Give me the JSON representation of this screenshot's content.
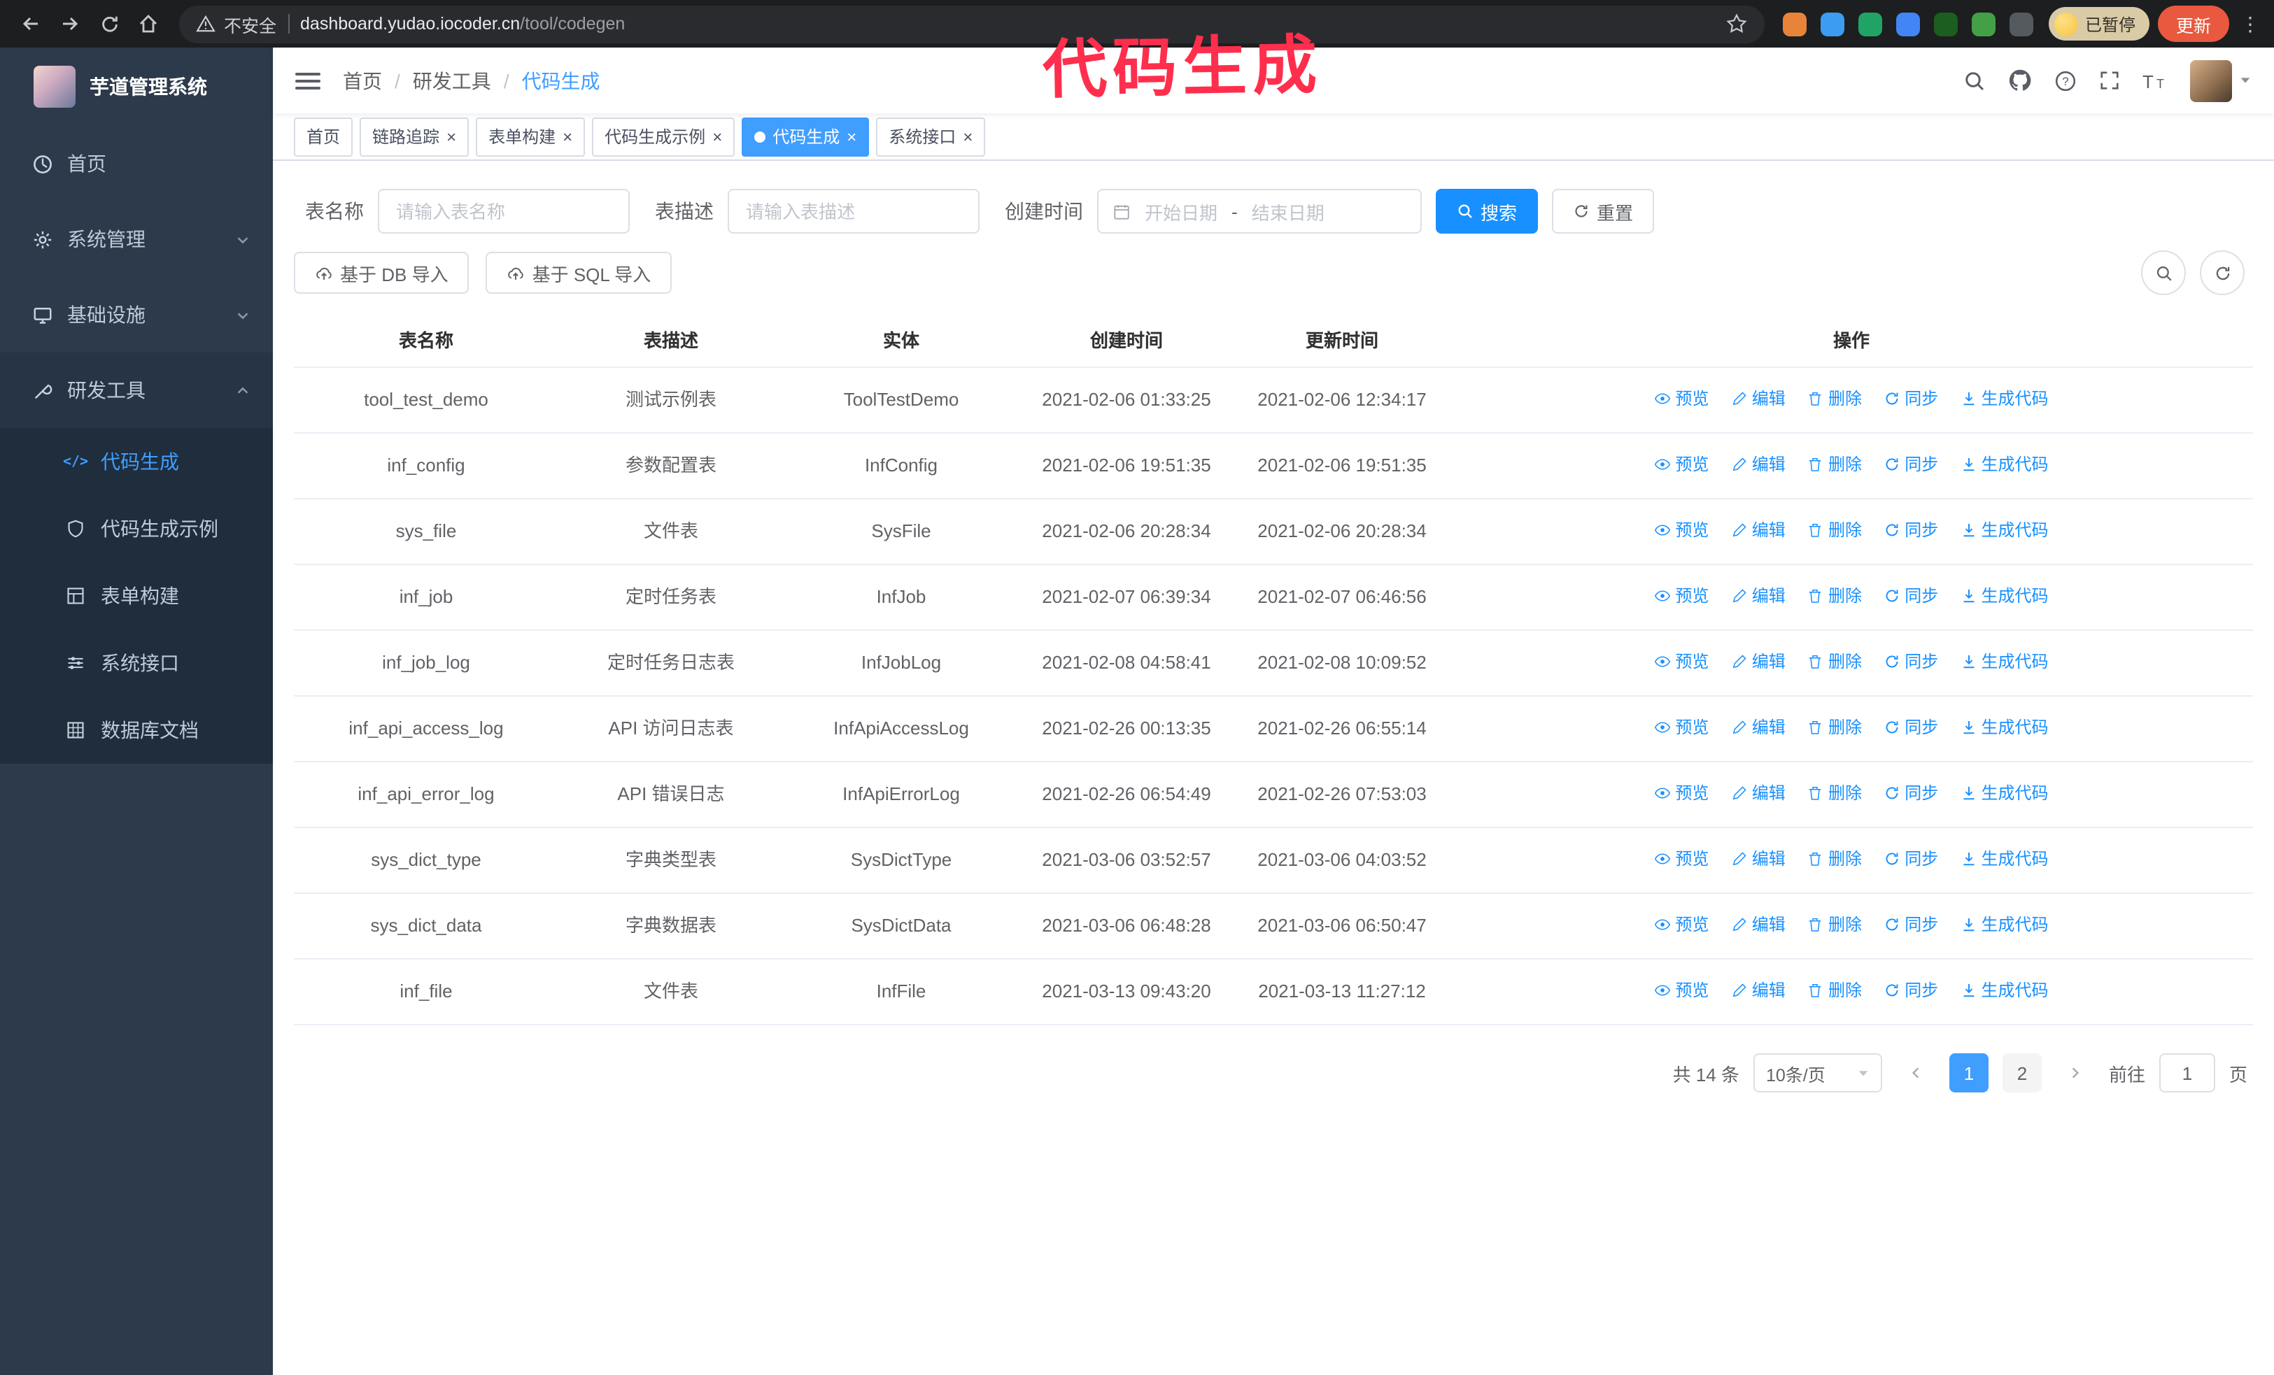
{
  "colors": {
    "accent_blue": "#1890ff",
    "tab_active_blue": "#409eff",
    "sidebar_bg": "#2d3a4b",
    "submenu_bg": "#1f2d3d",
    "annotation_pink": "#ff2e4d",
    "update_button_orange": "#e8593f",
    "paused_badge_tan": "#d8cba6"
  },
  "annotation": {
    "text": "代码生成"
  },
  "browser": {
    "security_label": "不安全",
    "url_host": "dashboard.yudao.iocoder.cn",
    "url_path": "/tool/codegen",
    "paused_badge": "已暂停",
    "update_button": "更新",
    "kebab": "⋮",
    "extensions": [
      {
        "color": "#e8833a"
      },
      {
        "color": "#3b9cf1"
      },
      {
        "color": "#21a366"
      },
      {
        "color": "#4285f4"
      },
      {
        "color": "#1b5e20"
      },
      {
        "color": "#43a047"
      },
      {
        "color": "#555a5f"
      }
    ]
  },
  "sidebar": {
    "app_title": "芋道管理系统",
    "items": [
      {
        "label": "首页"
      },
      {
        "label": "系统管理"
      },
      {
        "label": "基础设施"
      },
      {
        "label": "研发工具"
      }
    ],
    "subitems": [
      {
        "label": "代码生成",
        "active": true
      },
      {
        "label": "代码生成示例"
      },
      {
        "label": "表单构建"
      },
      {
        "label": "系统接口"
      },
      {
        "label": "数据库文档"
      }
    ]
  },
  "header": {
    "breadcrumb": [
      "首页",
      "研发工具",
      "代码生成"
    ],
    "separator": "/"
  },
  "tabs_meta": {
    "close_glyph": "×"
  },
  "tabs": [
    {
      "label": "首页"
    },
    {
      "label": "链路追踪"
    },
    {
      "label": "表单构建"
    },
    {
      "label": "代码生成示例"
    },
    {
      "label": "代码生成"
    },
    {
      "label": "系统接口"
    }
  ],
  "filters": {
    "table_name_label": "表名称",
    "table_name_placeholder": "请输入表名称",
    "table_desc_label": "表描述",
    "table_desc_placeholder": "请输入表描述",
    "create_time_label": "创建时间",
    "date_start_placeholder": "开始日期",
    "date_separator": "-",
    "date_end_placeholder": "结束日期",
    "search_button": "搜索",
    "reset_button": "重置"
  },
  "toolbar": {
    "import_db": "基于 DB 导入",
    "import_sql": "基于 SQL 导入"
  },
  "table": {
    "columns": [
      "表名称",
      "表描述",
      "实体",
      "创建时间",
      "更新时间",
      "操作"
    ],
    "actions": [
      "预览",
      "编辑",
      "删除",
      "同步",
      "生成代码"
    ],
    "rows": [
      {
        "name": "tool_test_demo",
        "desc": "测试示例表",
        "entity": "ToolTestDemo",
        "created": "2021-02-06 01:33:25",
        "updated": "2021-02-06 12:34:17"
      },
      {
        "name": "inf_config",
        "desc": "参数配置表",
        "entity": "InfConfig",
        "created": "2021-02-06 19:51:35",
        "updated": "2021-02-06 19:51:35"
      },
      {
        "name": "sys_file",
        "desc": "文件表",
        "entity": "SysFile",
        "created": "2021-02-06 20:28:34",
        "updated": "2021-02-06 20:28:34"
      },
      {
        "name": "inf_job",
        "desc": "定时任务表",
        "entity": "InfJob",
        "created": "2021-02-07 06:39:34",
        "updated": "2021-02-07 06:46:56"
      },
      {
        "name": "inf_job_log",
        "desc": "定时任务日志表",
        "entity": "InfJobLog",
        "created": "2021-02-08 04:58:41",
        "updated": "2021-02-08 10:09:52"
      },
      {
        "name": "inf_api_access_log",
        "desc": "API 访问日志表",
        "entity": "InfApiAccessLog",
        "created": "2021-02-26 00:13:35",
        "updated": "2021-02-26 06:55:14"
      },
      {
        "name": "inf_api_error_log",
        "desc": "API 错误日志",
        "entity": "InfApiErrorLog",
        "created": "2021-02-26 06:54:49",
        "updated": "2021-02-26 07:53:03"
      },
      {
        "name": "sys_dict_type",
        "desc": "字典类型表",
        "entity": "SysDictType",
        "created": "2021-03-06 03:52:57",
        "updated": "2021-03-06 04:03:52"
      },
      {
        "name": "sys_dict_data",
        "desc": "字典数据表",
        "entity": "SysDictData",
        "created": "2021-03-06 06:48:28",
        "updated": "2021-03-06 06:50:47"
      },
      {
        "name": "inf_file",
        "desc": "文件表",
        "entity": "InfFile",
        "created": "2021-03-13 09:43:20",
        "updated": "2021-03-13 11:27:12"
      }
    ]
  },
  "pagination": {
    "total": "共 14 条",
    "page_size": "10条/页",
    "pages": [
      "1",
      "2"
    ],
    "goto_label": "前往",
    "goto_value": "1",
    "page_unit": "页"
  }
}
